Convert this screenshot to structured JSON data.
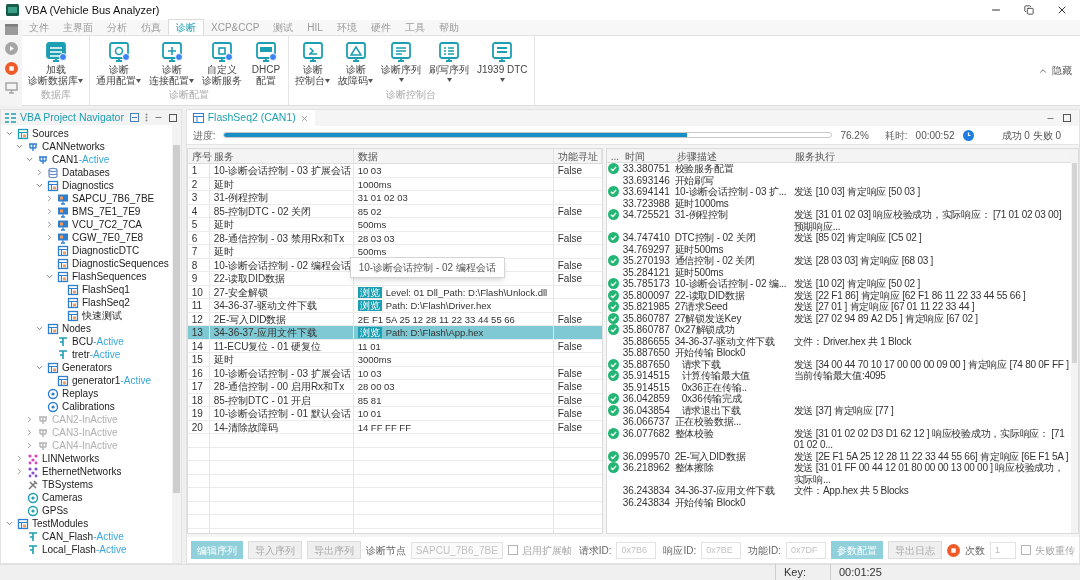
{
  "window": {
    "title": "VBA (Vehicle Bus Analyzer)"
  },
  "menu_tabs": [
    {
      "label": "文件",
      "selected": false
    },
    {
      "label": "主界面",
      "selected": false
    },
    {
      "label": "分析",
      "selected": false
    },
    {
      "label": "仿真",
      "selected": false
    },
    {
      "label": "诊断",
      "selected": true
    },
    {
      "label": "XCP&CCP",
      "selected": false
    },
    {
      "label": "测试",
      "selected": false
    },
    {
      "label": "HIL",
      "selected": false
    },
    {
      "label": "环境",
      "selected": false
    },
    {
      "label": "硬件",
      "selected": false
    },
    {
      "label": "工具",
      "selected": false
    },
    {
      "label": "帮助",
      "selected": false
    }
  ],
  "ribbon": {
    "groups": [
      {
        "label": "数据库",
        "buttons": [
          {
            "kind": "database",
            "lines": [
              "加载",
              "诊断数据库"
            ],
            "dropdown": true
          }
        ]
      },
      {
        "label": "诊断配置",
        "buttons": [
          {
            "kind": "config",
            "lines": [
              "诊断",
              "通用配置"
            ],
            "dropdown": true
          },
          {
            "kind": "connect",
            "lines": [
              "诊断",
              "连接配置"
            ],
            "dropdown": true
          },
          {
            "kind": "service",
            "lines": [
              "自定义",
              "诊断服务"
            ],
            "dropdown": false
          },
          {
            "kind": "dhcp",
            "lines": [
              "DHCP",
              "配置"
            ],
            "dropdown": false
          }
        ]
      },
      {
        "label": "诊断控制台",
        "buttons": [
          {
            "kind": "console",
            "lines": [
              "诊断",
              "控制台"
            ],
            "dropdown": true
          },
          {
            "kind": "dtc",
            "lines": [
              "诊断",
              "故障码"
            ],
            "dropdown": true
          },
          {
            "kind": "sequence",
            "lines": [
              "诊断序列"
            ],
            "dropdown": true
          },
          {
            "kind": "flash",
            "lines": [
              "刷写序列"
            ],
            "dropdown": true
          },
          {
            "kind": "j1939",
            "lines": [
              "J1939 DTC"
            ],
            "dropdown": true
          }
        ]
      }
    ],
    "hide_label": "隐藏"
  },
  "navigator": {
    "title": "VBA Project Navigator",
    "tree": [
      {
        "label": "Sources",
        "kind": "sources",
        "expanded": true,
        "children": [
          {
            "label": "CANNetworks",
            "kind": "network",
            "expanded": true,
            "children": [
              {
                "label": "CAN1",
                "status": "-Active",
                "kind": "network",
                "disabled": false,
                "expanded": true,
                "children": [
                  {
                    "label": "Databases",
                    "kind": "database",
                    "expanded": false
                  },
                  {
                    "label": "Diagnostics",
                    "kind": "diagnostics",
                    "expanded": true,
                    "children": [
                      {
                        "label": "SAPCU_7B6_7BE",
                        "kind": "ecu",
                        "expanded": false
                      },
                      {
                        "label": "BMS_7E1_7E9",
                        "kind": "ecu",
                        "expanded": false
                      },
                      {
                        "label": "VCU_7C2_7CA",
                        "kind": "ecu",
                        "expanded": false
                      },
                      {
                        "label": "CGW_7E0_7E8",
                        "kind": "ecu",
                        "expanded": false
                      },
                      {
                        "label": "DiagnosticDTC",
                        "kind": "table"
                      },
                      {
                        "label": "DiagnosticSequences",
                        "kind": "table"
                      },
                      {
                        "label": "FlashSequences",
                        "kind": "table",
                        "expanded": true,
                        "children": [
                          {
                            "label": "FlashSeq1",
                            "kind": "table"
                          },
                          {
                            "label": "FlashSeq2",
                            "kind": "table"
                          },
                          {
                            "label": "快速测试",
                            "kind": "table"
                          }
                        ]
                      }
                    ]
                  },
                  {
                    "label": "Nodes",
                    "kind": "nodes",
                    "expanded": true,
                    "children": [
                      {
                        "label": "BCU",
                        "status": "-Active",
                        "kind": "node"
                      },
                      {
                        "label": "tretr",
                        "status": "-Active",
                        "kind": "node"
                      }
                    ]
                  },
                  {
                    "label": "Generators",
                    "kind": "generators",
                    "expanded": true,
                    "children": [
                      {
                        "label": "generator1",
                        "status": "-Active",
                        "kind": "generator"
                      }
                    ]
                  },
                  {
                    "label": "Replays",
                    "kind": "replay"
                  },
                  {
                    "label": "Calibrations",
                    "kind": "calibration"
                  }
                ]
              },
              {
                "label": "CAN2-InActive",
                "kind": "network",
                "disabled": true,
                "expanded": false
              },
              {
                "label": "CAN3-InActive",
                "kind": "network",
                "disabled": true,
                "expanded": false
              },
              {
                "label": "CAN4-InActive",
                "kind": "network",
                "disabled": true,
                "expanded": false
              }
            ]
          },
          {
            "label": "LINNetworks",
            "kind": "lin",
            "expanded": false
          },
          {
            "label": "EthernetNetworks",
            "kind": "ethernet",
            "expanded": false
          },
          {
            "label": "TBSystems",
            "kind": "tools"
          },
          {
            "label": "Cameras",
            "kind": "camera"
          },
          {
            "label": "GPSs",
            "kind": "gps"
          }
        ]
      },
      {
        "label": "TestModules",
        "kind": "testmodules",
        "expanded": true,
        "children": [
          {
            "label": "CAN_Flash",
            "status": "-Active",
            "kind": "test"
          },
          {
            "label": "Local_Flash",
            "status": "-Active",
            "kind": "test"
          }
        ]
      }
    ]
  },
  "editor": {
    "tab": "FlashSeq2 (CAN1)",
    "progress": {
      "label": "进度:",
      "level": 0.762,
      "percent": "76.2%",
      "elapsed_label": "耗时:",
      "elapsed": "00:00:52",
      "result": "成功 0 失败 0"
    },
    "sequence": {
      "columns": [
        "序号",
        "服务",
        "数据",
        "功能寻址"
      ],
      "tooltip": "10-诊断会话控制 - 02 编程会话",
      "rows": [
        {
          "no": "1",
          "service": "10-诊断会话控制 - 03 扩展会话",
          "data": "10 03",
          "functional": "False",
          "selected": false
        },
        {
          "no": "2",
          "service": "延时",
          "data": "1000ms",
          "selected": false
        },
        {
          "no": "3",
          "service": "31-例程控制",
          "data": "31 01 02 03",
          "selected": false
        },
        {
          "no": "4",
          "service": "85-控制DTC - 02 关闭",
          "data": "85 02",
          "functional": "False",
          "selected": false
        },
        {
          "no": "5",
          "service": "延时",
          "data": "500ms",
          "selected": false
        },
        {
          "no": "6",
          "service": "28-通信控制 - 03 禁用Rx和Tx",
          "data": "28 03 03",
          "functional": "False",
          "selected": false
        },
        {
          "no": "7",
          "service": "延时",
          "data": "500ms",
          "selected": false
        },
        {
          "no": "8",
          "service": "10-诊断会话控制 - 02 编程会话",
          "functional": "False",
          "selected": false
        },
        {
          "no": "9",
          "service": "22-读取DID数据",
          "functional": "False",
          "selected": false
        },
        {
          "no": "10",
          "service": "27-安全解锁",
          "browse": "浏览",
          "data": "Level: 01 Dll_Path: D:\\Flash\\Unlock.dll",
          "selected": false
        },
        {
          "no": "11",
          "service": "34-36-37-驱动文件下载",
          "browse": "浏览",
          "data": "Path: D:\\Flash\\Driver.hex",
          "selected": false
        },
        {
          "no": "12",
          "service": "2E-写入DID数据",
          "data": "2E F1 5A 25 12 28 11 22 33 44 55 66",
          "functional": "False",
          "selected": false
        },
        {
          "no": "13",
          "service": "34-36-37-应用文件下载",
          "browse": "浏览",
          "data": "Path: D:\\Flash\\App.hex",
          "selected": true
        },
        {
          "no": "14",
          "service": "11-ECU复位 - 01 硬复位",
          "data": "11 01",
          "functional": "False",
          "selected": false
        },
        {
          "no": "15",
          "service": "延时",
          "data": "3000ms",
          "selected": false
        },
        {
          "no": "16",
          "service": "10-诊断会话控制 - 03 扩展会话",
          "data": "10 03",
          "functional": "False",
          "selected": false
        },
        {
          "no": "17",
          "service": "28-通信控制 - 00 启用Rx和Tx",
          "data": "28 00 03",
          "functional": "False",
          "selected": false
        },
        {
          "no": "18",
          "service": "85-控制DTC - 01 开启",
          "data": "85 81",
          "functional": "False",
          "selected": false
        },
        {
          "no": "19",
          "service": "10-诊断会话控制 - 01 默认会话",
          "data": "10 01",
          "functional": "False",
          "selected": false
        },
        {
          "no": "20",
          "service": "14-清除故障码",
          "data": "14 FF FF FF",
          "functional": "False",
          "selected": false
        }
      ]
    },
    "log": {
      "columns": [
        "...",
        "时间",
        "步骤描述",
        "服务执行"
      ],
      "rows": [
        {
          "ok": true,
          "time": "33.380751",
          "step": "校验服务配置"
        },
        {
          "ok": false,
          "time": "33.693146",
          "step": "开始刷写"
        },
        {
          "ok": true,
          "time": "33.694141",
          "step": "10-诊断会话控制 - 03 扩...",
          "exec": "发送 [10 03] 肯定响应 [50 03 ]"
        },
        {
          "ok": false,
          "time": "33.723988",
          "step": "延时1000ms"
        },
        {
          "ok": true,
          "time": "34.725521",
          "step": "31-例程控制",
          "exec": "发送 [31 01 02 03] 响应校验成功，实际响应： [71 01 02 03 00] 预期响应..."
        },
        {
          "ok": true,
          "time": "34.747410",
          "step": "DTC控制 - 02 关闭",
          "exec": "发送 [85 02] 肯定响应 [C5 02 ]"
        },
        {
          "ok": false,
          "time": "34.769297",
          "step": "延时500ms"
        },
        {
          "ok": true,
          "time": "35.270193",
          "step": "通信控制 - 02 关闭",
          "exec": "发送 [28 03 03] 肯定响应 [68 03 ]"
        },
        {
          "ok": false,
          "time": "35.284121",
          "step": "延时500ms"
        },
        {
          "ok": true,
          "time": "35.785173",
          "step": "10-诊断会话控制 - 02 编...",
          "exec": "发送 [10 02] 肯定响应 [50 02 ]"
        },
        {
          "ok": true,
          "time": "35.800097",
          "step": "22-读取DID数据",
          "exec": "发送 [22 F1 86] 肯定响应 [62 F1 86 11 22 33 44 55 66 ]"
        },
        {
          "ok": true,
          "time": "35.821985",
          "step": "27请求Seed",
          "exec": "发送 [27 01 ] 肯定响应 [67 01 11 22 33 44 ]"
        },
        {
          "ok": true,
          "time": "35.860787",
          "step": "27解锁发送Key",
          "exec": "发送 [27 02 94 89 A2 D5 ] 肯定响应 [67 02 ]"
        },
        {
          "ok": true,
          "time": "35.860787",
          "step": "0x27解锁成功"
        },
        {
          "ok": false,
          "time": "35.886655",
          "step": "34-36-37-驱动文件下载",
          "exec": "文件：Driver.hex   共 1 Block"
        },
        {
          "ok": false,
          "time": "35.887650",
          "step": "开始传输 Block0",
          "children": [
            {
              "ok": true,
              "time": "35.887650",
              "step": "请求下载",
              "exec": "发送 [34 00 44 70 10 17 00 00 00 09 00 ] 肯定响应 [74 80 0F FF ]"
            },
            {
              "ok": true,
              "time": "35.914515",
              "step": "计算传输最大值",
              "exec": "当前传输最大值:4095"
            },
            {
              "ok": false,
              "time": "35.914515",
              "step": "0x36正在传输.."
            },
            {
              "ok": true,
              "time": "36.042859",
              "step": "0x36传输完成"
            },
            {
              "ok": true,
              "time": "36.043854",
              "step": "请求退出下载",
              "exec": "发送 [37] 肯定响应 [77 ]"
            }
          ]
        },
        {
          "ok": false,
          "time": "36.066737",
          "step": "正在校验数据..."
        },
        {
          "ok": true,
          "time": "36.077682",
          "step": "整体校验",
          "exec": "发送 [31 01 02 02 D3 D1 62 12 ] 响应校验成功，实际响应： [71 01 02 0..."
        },
        {
          "ok": true,
          "time": "36.099570",
          "step": "2E-写入DID数据",
          "exec": "发送 [2E F1 5A 25 12 28 11 22 33 44 55 66] 肯定响应 [6E F1 5A ]"
        },
        {
          "ok": true,
          "time": "36.218962",
          "step": "整体擦除",
          "exec": "发送 [31 01 FF 00 44 12 01 80 00 00 13 00 00 ] 响应校验成功，实际响..."
        },
        {
          "ok": false,
          "time": "36.243834",
          "step": "34-36-37-应用文件下载",
          "exec": "文件：App.hex   共 5 Blocks"
        },
        {
          "ok": false,
          "time": "36.243834",
          "step": "开始传输 Block0"
        }
      ]
    },
    "controls": {
      "buttons": [
        {
          "label": "编辑序列",
          "kind": "primary"
        },
        {
          "label": "导入序列",
          "kind": "secondary"
        },
        {
          "label": "导出序列",
          "kind": "secondary"
        }
      ],
      "node_label": "诊断节点",
      "node_value": "SAPCU_7B6_7BE",
      "extended_frame": {
        "label": "启用扩展帧",
        "checked": false
      },
      "ids": [
        {
          "label": "请求ID:",
          "placeholder": "0x7B6"
        },
        {
          "label": "响应ID:",
          "placeholder": "0x7BE"
        },
        {
          "label": "功能ID:",
          "placeholder": "0x7DF"
        }
      ],
      "config_button": {
        "label": "参数配置",
        "kind": "primary"
      },
      "export_log_button": {
        "label": "导出日志",
        "kind": "secondary"
      },
      "count_label": "次数",
      "count_value": "1",
      "retry": {
        "label": "失败重传",
        "checked": false
      }
    }
  },
  "status_bar": {
    "key_label": "Key:",
    "time": "00:01:25"
  }
}
